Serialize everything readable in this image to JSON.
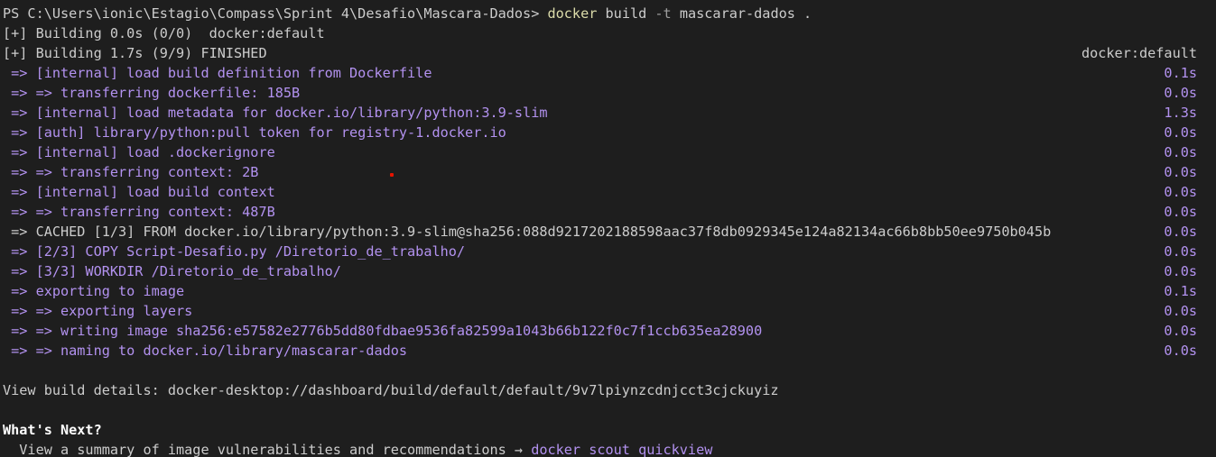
{
  "prompt": {
    "path": "PS C:\\Users\\ionic\\Estagio\\Compass\\Sprint 4\\Desafio\\Mascara-Dados>",
    "command": "docker",
    "subcommand": "build",
    "flag": "-t",
    "args": "mascarar-dados ."
  },
  "building_initial": "[+] Building 0.0s (0/0)  docker:default",
  "building_finished": "[+] Building 1.7s (9/9) FINISHED",
  "building_context": "docker:default",
  "steps": [
    {
      "text": " => [internal] load build definition from Dockerfile",
      "time": "0.1s"
    },
    {
      "text": " => => transferring dockerfile: 185B",
      "time": "0.0s"
    },
    {
      "text": " => [internal] load metadata for docker.io/library/python:3.9-slim",
      "time": "1.3s"
    },
    {
      "text": " => [auth] library/python:pull token for registry-1.docker.io",
      "time": "0.0s"
    },
    {
      "text": " => [internal] load .dockerignore",
      "time": "0.0s"
    },
    {
      "text": " => => transferring context: 2B",
      "time": "0.0s"
    },
    {
      "text": " => [internal] load build context",
      "time": "0.0s"
    },
    {
      "text": " => => transferring context: 487B",
      "time": "0.0s"
    },
    {
      "text": " => CACHED [1/3] FROM docker.io/library/python:3.9-slim@sha256:088d9217202188598aac37f8db0929345e124a82134ac66b8bb50ee9750b045b",
      "time": "0.0s"
    },
    {
      "text": " => [2/3] COPY Script-Desafio.py /Diretorio_de_trabalho/",
      "time": "0.0s"
    },
    {
      "text": " => [3/3] WORKDIR /Diretorio_de_trabalho/",
      "time": "0.0s"
    },
    {
      "text": " => exporting to image",
      "time": "0.1s"
    },
    {
      "text": " => => exporting layers",
      "time": "0.0s"
    },
    {
      "text": " => => writing image sha256:e57582e2776b5dd80fdbae9536fa82599a1043b66b122f0c7f1ccb635ea28900",
      "time": "0.0s"
    },
    {
      "text": " => => naming to docker.io/library/mascarar-dados",
      "time": "0.0s"
    }
  ],
  "build_details": "View build details: docker-desktop://dashboard/build/default/default/9v7lpiynzcdnjcct3cjckuyiz",
  "whats_next": {
    "heading": "What's Next?",
    "hint_text": "  View a summary of image vulnerabilities and recommendations → ",
    "hint_command": "docker scout quickview"
  },
  "colors": {
    "background": "#1e1e1e",
    "text": "#cccccc",
    "step_purple": "#b392f0",
    "command_yellow": "#dcdcaa"
  }
}
